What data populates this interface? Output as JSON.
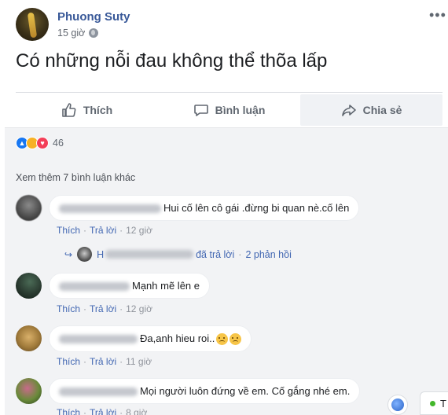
{
  "post": {
    "author": "Phuong Suty",
    "time": "15 giờ",
    "privacy_icon": "globe-icon",
    "text": "Có những nỗi đau không thể thõa lấp",
    "more_icon": "•••"
  },
  "actions": {
    "like": "Thích",
    "comment": "Bình luận",
    "share": "Chia sẻ"
  },
  "reactions": {
    "types": [
      "like",
      "sad",
      "love"
    ],
    "count": "46"
  },
  "view_more": "Xem thêm 7 bình luận khác",
  "comments": [
    {
      "text": "Hui cố lên cô gái .đừng bi quan nè.cố lên",
      "like": "Thích",
      "reply": "Trả lời",
      "time": "12 giờ"
    },
    {
      "text": "Mạnh mẽ lên e",
      "like": "Thích",
      "reply": "Trả lời",
      "time": "12 giờ"
    },
    {
      "text": "Đa,anh hieu roi..",
      "like": "Thích",
      "reply": "Trả lời",
      "time": "11 giờ"
    },
    {
      "text": "Mọi người luôn đứng về em. Cố gắng nhé em.",
      "like": "Thích",
      "reply": "Trả lời",
      "time": "8 giờ"
    }
  ],
  "reply_summary": {
    "initial": "H",
    "replied": "đã trả lời",
    "count": "2 phản hồi"
  },
  "chat_tab": {
    "label": "T"
  },
  "colors": {
    "link": "#385898",
    "accent": "#4267b2",
    "background": "#f2f3f5"
  }
}
